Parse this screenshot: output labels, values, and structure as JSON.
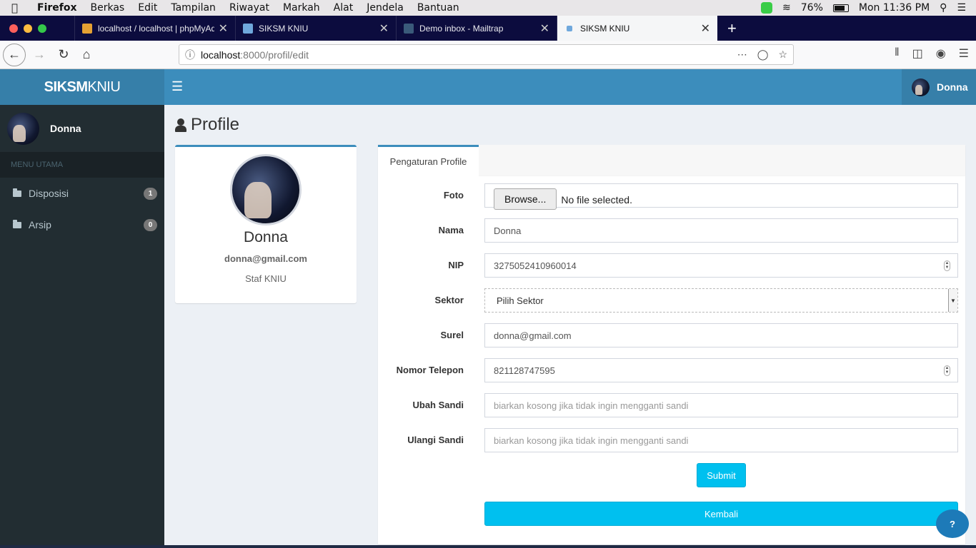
{
  "os_menubar": {
    "apple": "",
    "app": "Firefox",
    "menus": [
      "Berkas",
      "Edit",
      "Tampilan",
      "Riwayat",
      "Markah",
      "Alat",
      "Jendela",
      "Bantuan"
    ],
    "battery": "76%",
    "clock": "Mon 11:36 PM"
  },
  "browser": {
    "tabs": [
      {
        "title": "localhost / localhost | phpMyAd",
        "favicon_color": "#e5a133"
      },
      {
        "title": "SIKSM KNIU",
        "favicon_color": "#6fa8dc"
      },
      {
        "title": "Demo inbox - Mailtrap",
        "favicon_color": "#3a5a7a"
      },
      {
        "title": "SIKSM KNIU",
        "favicon_color": "#6fa8dc"
      }
    ],
    "url_host": "localhost",
    "url_path": ":8000/profil/edit"
  },
  "app": {
    "logo_bold": "SIKSM",
    "logo_rest": "KNIU",
    "header_user": "Donna",
    "sidebar": {
      "user": "Donna",
      "section": "MENU UTAMA",
      "items": [
        {
          "label": "Disposisi",
          "badge": "1"
        },
        {
          "label": "Arsip",
          "badge": "0"
        }
      ]
    },
    "page_title": "Profile",
    "profile": {
      "name": "Donna",
      "email": "donna@gmail.com",
      "role": "Staf KNIU"
    },
    "tab_label": "Pengaturan Profile",
    "form": {
      "foto_label": "Foto",
      "browse": "Browse...",
      "no_file": "No file selected.",
      "nama_label": "Nama",
      "nama_value": "Donna",
      "nip_label": "NIP",
      "nip_value": "3275052410960014",
      "sektor_label": "Sektor",
      "sektor_value": "Pilih Sektor",
      "surel_label": "Surel",
      "surel_value": "donna@gmail.com",
      "telp_label": "Nomor Telepon",
      "telp_value": "821128747595",
      "sandi_label": "Ubah Sandi",
      "sandi_placeholder": "biarkan kosong jika tidak ingin mengganti sandi",
      "ulangi_label": "Ulangi Sandi",
      "ulangi_placeholder": "biarkan kosong jika tidak ingin mengganti sandi",
      "submit": "Submit",
      "kembali": "Kembali"
    },
    "help": "?"
  },
  "colors": {
    "header": "#3c8dbc",
    "sidebar": "#222d32",
    "accent_button": "#00c0ef"
  }
}
